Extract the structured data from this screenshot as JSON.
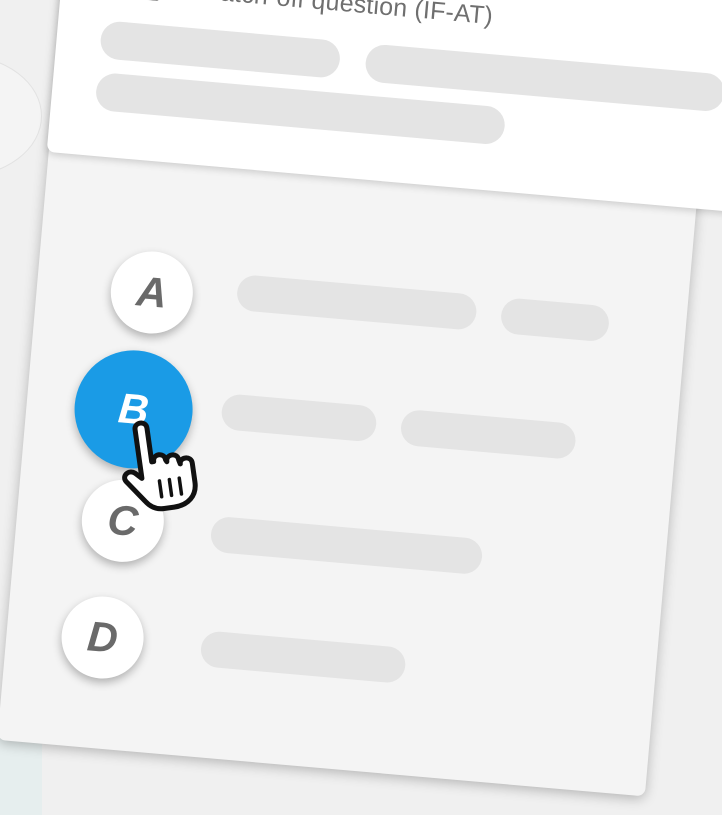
{
  "question": {
    "title": "Scratch-off question (IF-AT)",
    "icon": "scratch-card-icon"
  },
  "options": [
    {
      "letter": "A",
      "selected": false
    },
    {
      "letter": "B",
      "selected": true
    },
    {
      "letter": "C",
      "selected": false
    },
    {
      "letter": "D",
      "selected": false
    }
  ],
  "colors": {
    "selected": "#1a9be6",
    "placeholder": "#e4e4e4",
    "text": "#6a6a6a"
  },
  "cursor": "hand-pointer-icon"
}
